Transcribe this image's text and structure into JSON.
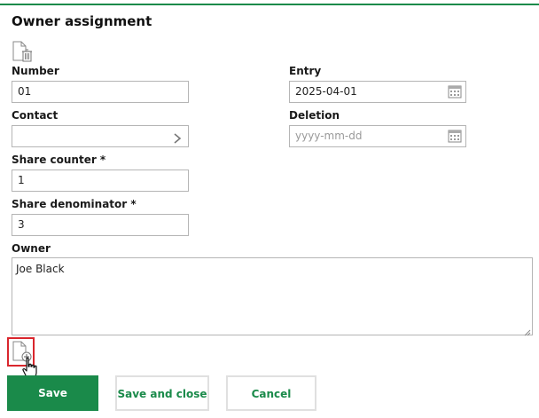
{
  "form": {
    "title": "Owner assignment"
  },
  "fields": {
    "number": {
      "label": "Number",
      "value": "01"
    },
    "entry": {
      "label": "Entry",
      "value": "2025-04-01"
    },
    "contact": {
      "label": "Contact",
      "value": ""
    },
    "deletion": {
      "label": "Deletion",
      "placeholder": "yyyy-mm-dd"
    },
    "share_counter": {
      "label": "Share counter *",
      "value": "1"
    },
    "share_denominator": {
      "label": "Share denominator *",
      "value": "3"
    },
    "owner": {
      "label": "Owner",
      "value": "Joe Black"
    }
  },
  "buttons": {
    "save": "Save",
    "save_and_close": "Save and close",
    "cancel": "Cancel"
  },
  "colors": {
    "accent": "#1a8a4a",
    "highlight_border": "#d9262d"
  },
  "icons": {
    "delete_document": "document-delete-icon",
    "add_document": "document-add-icon",
    "calendar": "calendar-icon",
    "chevron": "chevron-right-icon",
    "cursor": "hand-pointer-cursor-icon"
  }
}
